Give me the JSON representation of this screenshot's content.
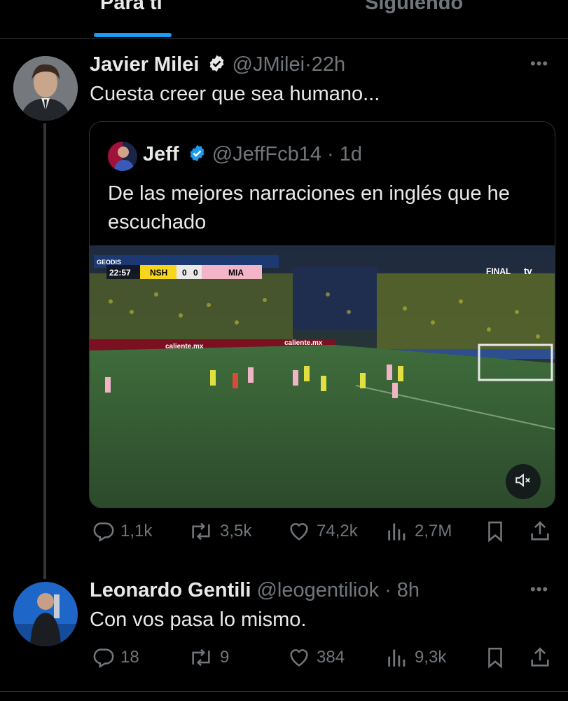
{
  "tabs": {
    "for_you": "Para ti",
    "following": "Siguiendo"
  },
  "post": {
    "name": "Javier Milei",
    "handle": "@JMilei",
    "time": "22h",
    "text": "Cuesta creer que sea humano...",
    "quote": {
      "name": "Jeff",
      "handle": "@JeffFcb14",
      "time": "1d",
      "text_line1": "De las mejores narraciones en inglés que he",
      "text_line2": "escuchado",
      "video": {
        "clock": "22:57",
        "home": "NSH",
        "home_score": "0",
        "away_score": "0",
        "away": "MIA",
        "network": "FINAL",
        "network2": "tv",
        "board_ad1": "caliente.mx",
        "board_ad2": "caliente.mx",
        "board_ad3": "GEODIS"
      }
    },
    "stats": {
      "replies": "1,1k",
      "reposts": "3,5k",
      "likes": "74,2k",
      "views": "2,7M"
    }
  },
  "reply": {
    "name": "Leonardo Gentili",
    "handle": "@leogentiliok",
    "time": "8h",
    "text": "Con vos pasa lo mismo.",
    "stats": {
      "replies": "18",
      "reposts": "9",
      "likes": "384",
      "views": "9,3k"
    }
  },
  "icons": {
    "verified": "verified-badge-icon",
    "more": "more-icon",
    "reply": "reply-icon",
    "repost": "repost-icon",
    "like": "heart-icon",
    "views": "views-icon",
    "bookmark": "bookmark-icon",
    "share": "share-icon",
    "mute": "mute-icon"
  },
  "colors": {
    "accent": "#1d9bf0",
    "muted": "#71767b",
    "background": "#000000",
    "text": "#e7e9ea"
  }
}
